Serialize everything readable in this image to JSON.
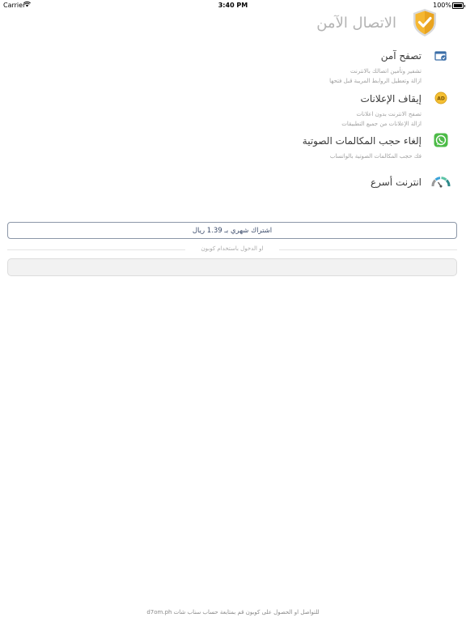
{
  "status_bar": {
    "carrier": "Carrier",
    "time": "3:40 PM",
    "battery": "100%"
  },
  "header": {
    "title": "الاتصال الآمن"
  },
  "features": [
    {
      "title": "تصفح آمن",
      "lines": [
        "تشفير وتأمين اتصالك بالانترنت",
        "ازالة وتعطيل الروابط المريبة قبل فتحها"
      ],
      "icon": "secure-browser-icon"
    },
    {
      "title": "إيقاف الإعلانات",
      "lines": [
        "تصفح الانترنت بدون اعلانات",
        "ازالة الإعلانات من جميع التطبيقات"
      ],
      "icon": "ad-block-icon"
    },
    {
      "title": "إلغاء حجب المكالمات الصوتية",
      "lines": [
        "فك حجب المكالمات الصوتية بالواتساب"
      ],
      "icon": "whatsapp-icon"
    },
    {
      "title": "انترنت أسرع",
      "lines": [],
      "icon": "speedometer-icon"
    }
  ],
  "subscribe_button": "اشتراك شهري بـ 1.39 ريال",
  "coupon_divider": "او الدخول باستخدام كوبون",
  "coupon_input": {
    "value": "",
    "placeholder": ""
  },
  "footer": "للتواصل او الحصول على كوبون قم بمتابعة حساب سناب شات d7om.ph",
  "colors": {
    "shield": "#f5b731",
    "button_border": "#8c97a8",
    "title_gray": "#b3b3b3"
  }
}
